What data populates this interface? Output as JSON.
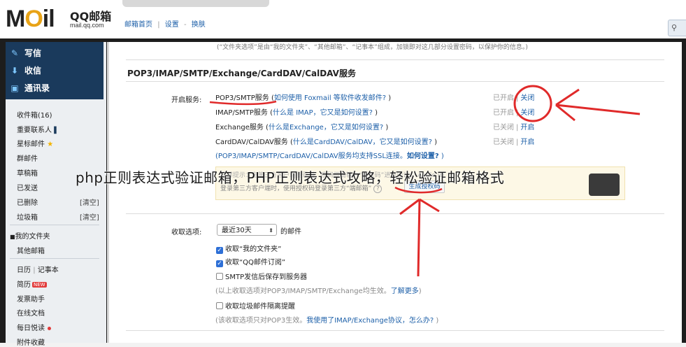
{
  "header": {
    "logo_text_pre": "M",
    "logo_text_o": "O",
    "logo_text_post": "il",
    "logo_cn": "QQ邮箱",
    "logo_url": "mail.qq.com",
    "nav": [
      "邮箱首页",
      "设置",
      "换肤"
    ],
    "nav_sep": "|",
    "nav_sep2": "-",
    "search_icon": "search-icon"
  },
  "sidebar": {
    "compose": [
      {
        "icon": "pencil-icon",
        "glyph": "✎",
        "label": "写信"
      },
      {
        "icon": "inbox-download-icon",
        "glyph": "⬇",
        "label": "收信"
      },
      {
        "icon": "contacts-icon",
        "glyph": "▣",
        "label": "通讯录"
      }
    ],
    "folders": [
      {
        "label": "收件箱(16)"
      },
      {
        "label": "重要联系人",
        "icon": "bookmark-icon",
        "glyph": "▌"
      },
      {
        "label": "星标邮件",
        "icon": "star-icon",
        "glyph": "★"
      },
      {
        "label": "群邮件"
      },
      {
        "label": "草稿箱"
      },
      {
        "label": "已发送"
      },
      {
        "label": "已删除",
        "right": "[清空]"
      },
      {
        "label": "垃圾箱",
        "right": "[清空]"
      }
    ],
    "my_folders": "我的文件夹",
    "other_mailbox": "其他邮箱",
    "apps": [
      {
        "label": "日历",
        "extra": "记事本"
      },
      {
        "label": "简历",
        "badge": "NEW"
      },
      {
        "label": "发票助手"
      },
      {
        "label": "在线文档"
      },
      {
        "label": "每日悦读",
        "dot": true
      },
      {
        "label": "附件收藏"
      }
    ]
  },
  "main": {
    "top_note": "(“文件夹选项”是由“我的文件夹”、“其他邮箱”、“记事本”组成，加锁即对这几部分设置密码，以保护你的信息。)",
    "section_title": "POP3/IMAP/SMTP/Exchange/CardDAV/CalDAV服务",
    "enable_label": "开启服务:",
    "services": [
      {
        "name": "POP3/SMTP服务",
        "open": " (",
        "link": "如何使用 Foxmail 等软件收发邮件?",
        "close": " )",
        "state": "已开启",
        "action": "关闭"
      },
      {
        "name": "IMAP/SMTP服务",
        "open": " (",
        "link": "什么是 IMAP，它又是如何设置?",
        "close": " )",
        "state": "已开启",
        "action": "关闭"
      },
      {
        "name": "Exchange服务",
        "open": " (",
        "link": "什么是Exchange，它又是如何设置?",
        "close": " )",
        "state": "已关闭",
        "action": "开启"
      },
      {
        "name": "CardDAV/CalDAV服务",
        "open": " (",
        "link": "什么是CardDAV/CalDAV，它又是如何设置?",
        "close": " )",
        "state": "已关闭",
        "action": "开启"
      }
    ],
    "ssl_note_pre": "(POP3/IMAP/SMTP/CardDAV/CalDAV服务均支持SSL连接。",
    "ssl_note_link": "如何设置?",
    "ssl_note_post": " )",
    "auth_line1": "温馨提示：在第三方客户端登录时，密码框请输入“授权码”进行验证。 Apple ID",
    "auth_line2": "登录第三方客户端时，使用授权码登录第三方“端邮箱”",
    "auth_q": "?",
    "auth_button": "生成授权码",
    "receive_label": "收取选项:",
    "receive_select": "最近30天",
    "receive_suffix": "的邮件",
    "checkboxes": [
      {
        "label": "收取“我的文件夹”",
        "checked": true
      },
      {
        "label": "收取“QQ邮件订阅”",
        "checked": true
      },
      {
        "label": "SMTP发信后保存到服务器",
        "checked": false
      }
    ],
    "receive_note_pre": "(以上收取选项对POP3/IMAP/SMTP/Exchange均生效。",
    "receive_note_link": "了解更多",
    "receive_note_post": ")",
    "junk_checkbox": {
      "label": "收取垃圾邮件隔离提醒",
      "checked": false
    },
    "junk_note_pre": "(该收取选项只对POP3生效。",
    "junk_note_link": "我使用了IMAP/Exchange协议，怎么办?",
    "junk_note_post": " )"
  },
  "overlay_caption": "php正则表达式验证邮箱，PHP正则表达式攻略，轻松验证邮箱格式",
  "colors": {
    "accent": "#1c5fa8",
    "annotation": "#e02a2a",
    "sidebar_dark": "#1a3a5c"
  }
}
